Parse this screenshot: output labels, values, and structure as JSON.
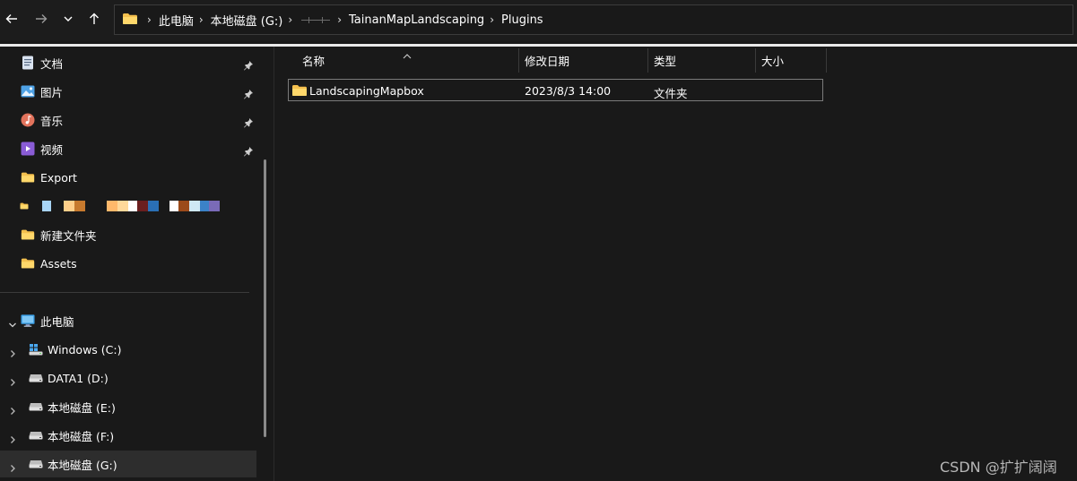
{
  "breadcrumb": {
    "items": [
      "此电脑",
      "本地磁盘 (G:)",
      "",
      "TainanMapLandscaping",
      "Plugins"
    ]
  },
  "sidebar": {
    "quick_access": [
      {
        "label": "文档",
        "icon": "document-icon",
        "pinned": true
      },
      {
        "label": "图片",
        "icon": "pictures-icon",
        "pinned": true
      },
      {
        "label": "音乐",
        "icon": "music-icon",
        "pinned": true
      },
      {
        "label": "视频",
        "icon": "videos-icon",
        "pinned": true
      },
      {
        "label": "Export",
        "icon": "folder-icon",
        "pinned": false
      },
      {
        "label": "",
        "icon": "folder-icon",
        "pinned": false,
        "redacted": true
      },
      {
        "label": "新建文件夹",
        "icon": "folder-icon",
        "pinned": false
      },
      {
        "label": "Assets",
        "icon": "folder-icon",
        "pinned": false
      }
    ],
    "this_pc": {
      "label": "此电脑",
      "icon": "computer-icon"
    },
    "drives": [
      {
        "label": "Windows (C:)",
        "icon": "windows-drive-icon"
      },
      {
        "label": "DATA1 (D:)",
        "icon": "drive-icon"
      },
      {
        "label": "本地磁盘 (E:)",
        "icon": "drive-icon"
      },
      {
        "label": "本地磁盘 (F:)",
        "icon": "drive-icon"
      },
      {
        "label": "本地磁盘 (G:)",
        "icon": "drive-icon",
        "selected": true
      }
    ]
  },
  "columns": {
    "name": "名称",
    "date": "修改日期",
    "type": "类型",
    "size": "大小"
  },
  "files": [
    {
      "name": "LandscapingMapbox",
      "date": "2023/8/3 14:00",
      "type": "文件夹",
      "size": ""
    }
  ],
  "watermark": "CSDN @扩扩阔阔",
  "colors": {
    "background": "#191919",
    "folder": "#f4c04e",
    "selection": "#2d2d2d"
  }
}
